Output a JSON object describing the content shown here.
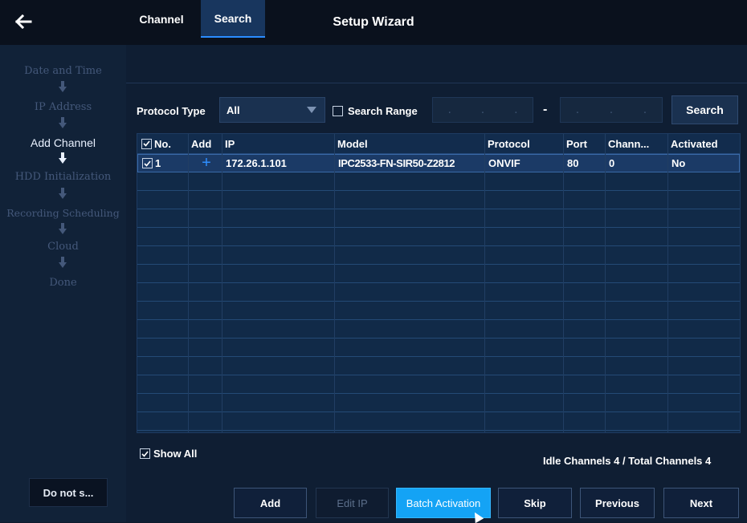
{
  "header": {
    "title": "Setup Wizard",
    "back_icon": "back-arrow-icon"
  },
  "sidebar": {
    "steps": [
      {
        "label": "Date and Time",
        "active": false
      },
      {
        "label": "IP Address",
        "active": false
      },
      {
        "label": "Add Channel",
        "active": true
      },
      {
        "label": "HDD Initialization",
        "active": false
      },
      {
        "label": "Recording Scheduling",
        "active": false
      },
      {
        "label": "Cloud",
        "active": false
      },
      {
        "label": "Done",
        "active": false
      }
    ],
    "dont_show_label": "Do not s..."
  },
  "tabs": [
    {
      "label": "Channel",
      "active": false
    },
    {
      "label": "Search",
      "active": true
    }
  ],
  "filters": {
    "protocol_label": "Protocol Type",
    "protocol_value": "All",
    "search_range_label": "Search Range",
    "search_range_checked": false,
    "range_separator": "-",
    "search_button": "Search"
  },
  "table": {
    "headers": [
      "No.",
      "Add",
      "IP",
      "Model",
      "Protocol",
      "Port",
      "Chann...",
      "Activated"
    ],
    "rows": [
      {
        "no": "1",
        "add": "+",
        "ip": "172.26.1.101",
        "model": "IPC2533-FN-SIR50-Z2812",
        "protocol": "ONVIF",
        "port": "80",
        "channel": "0",
        "activated": "No",
        "checked": true
      }
    ]
  },
  "footer": {
    "show_all_label": "Show All",
    "show_all_checked": true,
    "counts_text": "Idle Channels 4 / Total Channels 4"
  },
  "buttons": {
    "add": "Add",
    "edit_ip": "Edit IP",
    "batch_activation": "Batch Activation",
    "skip": "Skip",
    "previous": "Previous",
    "next": "Next"
  },
  "colors": {
    "accent": "#14a3f5",
    "active_step": "#e9f1ff",
    "inactive_step": "#44587a",
    "add_plus": "#2f8fff"
  }
}
